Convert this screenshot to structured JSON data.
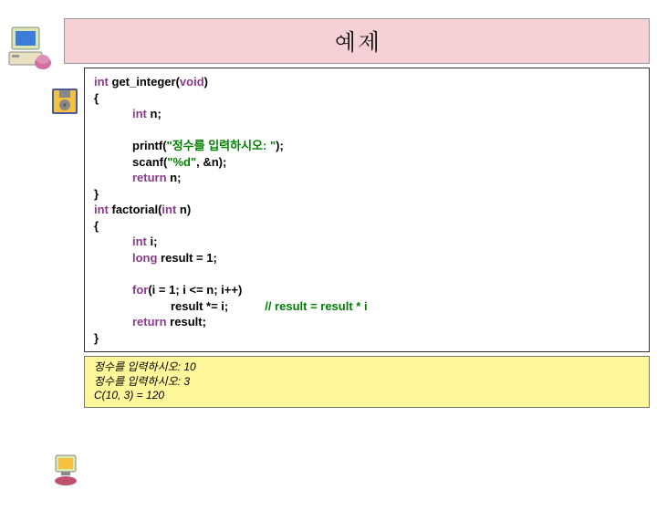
{
  "title": "예제",
  "code": {
    "l1a": "int",
    "l1b": " get_integer(",
    "l1c": "void",
    "l1d": ")",
    "l2": "{",
    "l3a": "int",
    "l3b": " n;",
    "l4a": "printf(",
    "l4b": "\"정수를 입력하시오: \"",
    "l4c": ");",
    "l5a": "scanf(",
    "l5b": "\"%d\"",
    "l5c": ", &n);",
    "l6a": "return",
    "l6b": " n;",
    "l7": "}",
    "l8a": "int",
    "l8b": " factorial(",
    "l8c": "int",
    "l8d": " n)",
    "l9": "{",
    "l10a": "int",
    "l10b": " i;",
    "l11a": "long",
    "l11b": " result = 1;",
    "l12a": "for",
    "l12b": "(i = 1; i <= n; i++)",
    "l13": "result *= i;",
    "l13c": "// result = result * i",
    "l14a": "return",
    "l14b": " result;",
    "l15": "}"
  },
  "output": {
    "o1": "정수를 입력하시오: 10",
    "o2": "정수를 입력하시오: 3",
    "o3": "C(10, 3) = 120"
  }
}
